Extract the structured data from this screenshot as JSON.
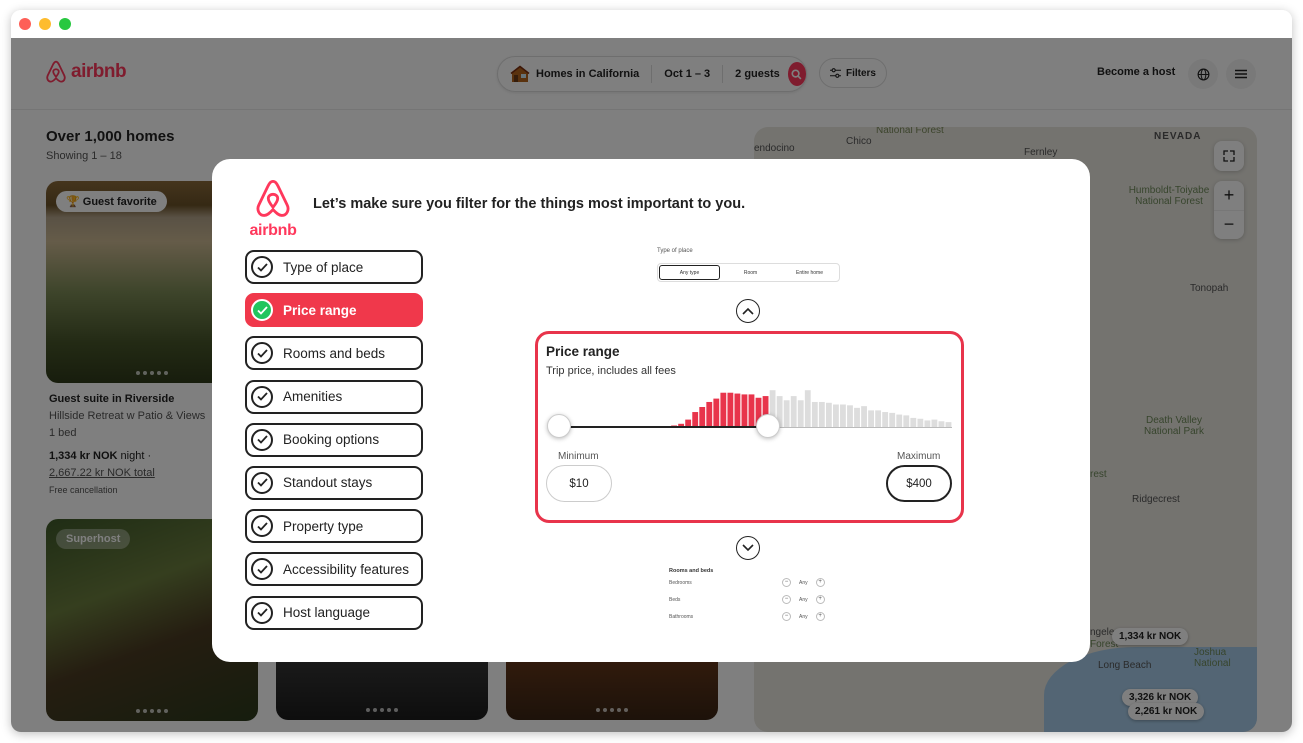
{
  "header": {
    "brand": "airbnb",
    "search_location": "Homes in California",
    "search_dates": "Oct 1 – 3",
    "search_guests": "2 guests",
    "filters_label": "Filters",
    "become_host": "Become a host"
  },
  "listings": {
    "title": "Over 1,000 homes",
    "subtitle": "Showing 1 – 18",
    "cards": [
      {
        "badge": "Guest favorite",
        "title": "Guest suite in Riverside",
        "description": "Hillside Retreat w Patio & Views",
        "beds": "1 bed",
        "price": "1,334 kr NOK",
        "price_unit": "night ·",
        "total": "2,667.22 kr NOK total",
        "note": "Free cancellation"
      },
      {
        "badge": "Superhost"
      }
    ]
  },
  "map": {
    "labels": [
      "NEVADA",
      "National Forest",
      "Chico",
      "endocino",
      "Fernley",
      "Humboldt-Toiyabe National Forest",
      "Tonopah",
      "Death Valley National Park",
      "Ridgecrest",
      "rest",
      "ngeles",
      "Forest",
      "Long Beach",
      "Joshua National"
    ],
    "pins": [
      "1,334 kr NOK",
      "3,326 kr NOK",
      "2,261 kr NOK"
    ]
  },
  "modal": {
    "logo_wordmark": "airbnb",
    "heading": "Let’s make sure you filter for the things most important to you.",
    "steps": [
      {
        "label": "Type of place",
        "active": false
      },
      {
        "label": "Price range",
        "active": true
      },
      {
        "label": "Rooms and beds",
        "active": false
      },
      {
        "label": "Amenities",
        "active": false
      },
      {
        "label": "Booking options",
        "active": false
      },
      {
        "label": "Standout stays",
        "active": false
      },
      {
        "label": "Property type",
        "active": false
      },
      {
        "label": "Accessibility features",
        "active": false
      },
      {
        "label": "Host language",
        "active": false
      }
    ],
    "type_of_place": {
      "title": "Type of place",
      "options": [
        "Any type",
        "Room",
        "Entire home"
      ],
      "selected": "Any type"
    },
    "price_range": {
      "title": "Price range",
      "subtitle": "Trip price, includes all fees",
      "min_label": "Minimum",
      "max_label": "Maximum",
      "min_value": "$10",
      "max_value": "$400",
      "selected_fraction_end": 0.53,
      "accent": "#e8344b"
    },
    "rooms_and_beds": {
      "title": "Rooms and beds",
      "rows": [
        {
          "label": "Bedrooms",
          "value": "Any"
        },
        {
          "label": "Beds",
          "value": "Any"
        },
        {
          "label": "Bathrooms",
          "value": "Any"
        }
      ]
    }
  },
  "colors": {
    "brand": "#ff385c",
    "active_step": "#f0384b",
    "check": "#22c55e"
  }
}
